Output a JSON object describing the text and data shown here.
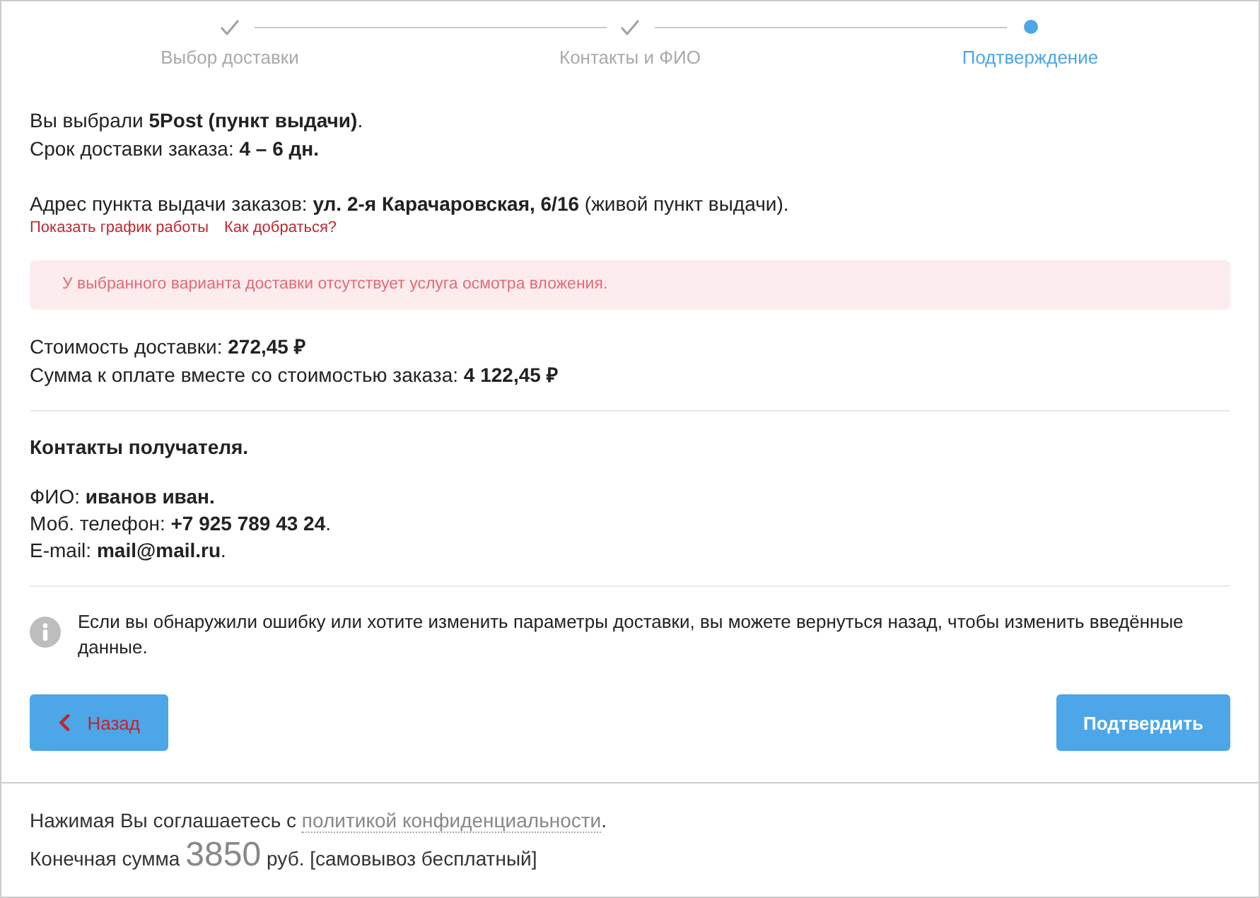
{
  "steps": [
    {
      "label": "Выбор доставки",
      "done": true,
      "selected": false
    },
    {
      "label": "Контакты и ФИО",
      "done": true,
      "selected": false
    },
    {
      "label": "Подтверждение",
      "done": false,
      "selected": true
    }
  ],
  "summary": {
    "service": "Вы выбрали **5Post (пункт выдачи)**.",
    "term": "Срок доставки заказа: **4 – 6 дн.**",
    "address": "Адрес пункта выдачи заказов: **ул. 2-я Карачаровская, 6/16** (живой пункт выдачи).",
    "links": [
      "Показать график работы",
      "Как добраться?"
    ]
  },
  "alert": {
    "text": "У выбранного варианта доставки отсутствует услуга осмотра вложения."
  },
  "costs": [
    "Стоимость доставки: **272,45 ₽**",
    "Сумма к оплате вместе со стоимостью заказа: **4 122,45 ₽**"
  ],
  "contacts": {
    "heading": "Контакты получателя.",
    "lines": [
      "ФИО: **иванов иван.**",
      "Моб. телефон: **+7 925 789 43 24**.",
      "E-mail: **mail@mail.ru**."
    ]
  },
  "note": "Если вы обнаружили ошибку или хотите изменить параметры доставки, вы можете вернуться назад, чтобы изменить введённые данные.",
  "buttons": {
    "back": "Назад",
    "confirm": "Подтвердить"
  },
  "footer": {
    "consent": {
      "before": "Нажимая Вы соглашаетесь с",
      "link": "политикой конфиденциальности",
      "after": "."
    },
    "total": {
      "label": "Конечная сумма",
      "amount": "3850",
      "suffix": "руб. [самовывоз бесплатный]"
    }
  }
}
